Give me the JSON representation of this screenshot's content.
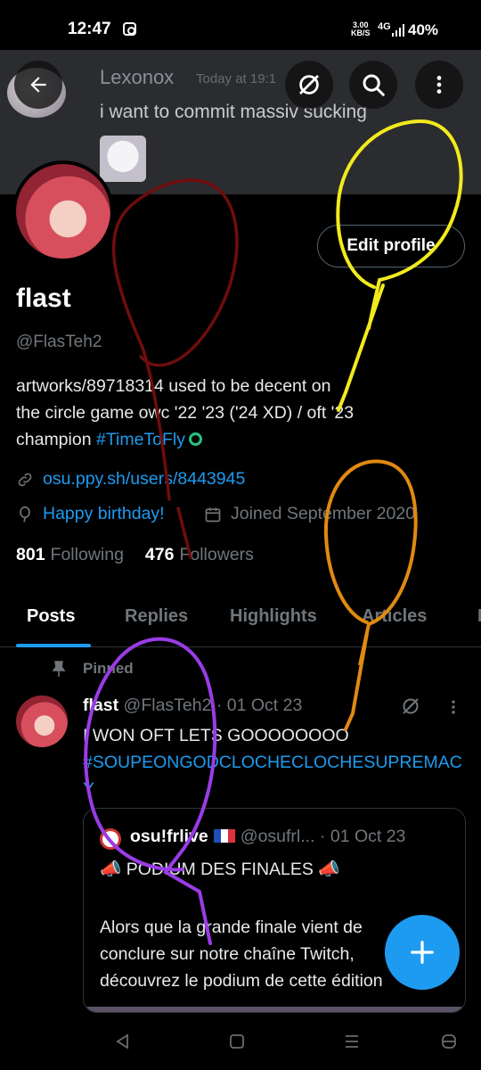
{
  "status_bar": {
    "time": "12:47",
    "network_speed_value": "3.00",
    "network_speed_unit": "KB/S",
    "network_type": "4G",
    "battery": "40%"
  },
  "banner": {
    "chat_username": "Lexonox",
    "chat_time": "Today at 19:1",
    "chat_message": "i want to commit massiv sucking"
  },
  "header_actions": {
    "back_icon": "arrow-left-icon",
    "grok_icon": "grok-icon",
    "search_icon": "search-icon",
    "more_icon": "more-vertical-icon"
  },
  "profile": {
    "edit_button": "Edit profile",
    "display_name": "flast",
    "handle": "@FlasTeh2",
    "bio_line1": "artworks/89718314 used to be decent on",
    "bio_line2": "the circle game owc '22 '23 ('24 XD) / oft '23",
    "bio_line3_text": "champion ",
    "bio_hashtag": "#TimeToFly",
    "link": "osu.ppy.sh/users/8443945",
    "birthday": "Happy birthday!",
    "joined": "Joined September 2020",
    "following_count": "801",
    "following_label": "Following",
    "followers_count": "476",
    "followers_label": "Followers"
  },
  "tabs": [
    {
      "label": "Posts"
    },
    {
      "label": "Replies"
    },
    {
      "label": "Highlights"
    },
    {
      "label": "Articles"
    },
    {
      "label": "M"
    }
  ],
  "post": {
    "pinned_label": "Pinned",
    "author": "flast",
    "handle": "@FlasTeh2",
    "date": "· 01 Oct 23",
    "text": "I WON OFT LETS GOOOOOOOO",
    "hashtag": "#SOUPEONGODCLOCHECLOCHESUPREMACY",
    "quote": {
      "author": "osu!frlive",
      "handle": "@osufrl...",
      "date": "· 01 Oct 23",
      "title": "📣 PODIUM DES FINALES 📣",
      "body_line1": "Alors que la grande finale vient de",
      "body_line2": "conclure sur notre chaîne Twitch,",
      "body_line3": "découvrez le podium de cette édition"
    }
  },
  "annotation_colors": {
    "red": "#6e0d0d",
    "yellow": "#f2ea1c",
    "orange": "#e08a12",
    "purple": "#9a3ce6"
  },
  "colors": {
    "accent": "#1d9bf0",
    "muted": "#71767b",
    "border": "#2f3336"
  }
}
